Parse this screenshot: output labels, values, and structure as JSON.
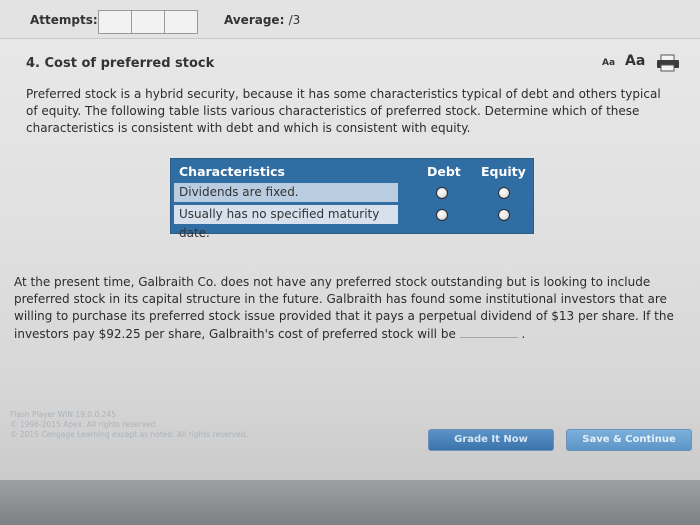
{
  "header": {
    "attempts_label": "Attempts:",
    "average_label": "Average:",
    "average_value": "/3"
  },
  "question": {
    "title": "4. Cost of preferred stock",
    "font_small": "Aa",
    "font_large": "Aa",
    "intro": "Preferred stock is a hybrid security, because it has some characteristics typical of debt and others typical of equity. The following table lists various characteristics of preferred stock. Determine which of these characteristics is consistent with debt and which is consistent with equity.",
    "table": {
      "headers": [
        "Characteristics",
        "Debt",
        "Equity"
      ],
      "rows": [
        "Dividends are fixed.",
        "Usually has no specified maturity date."
      ]
    },
    "paragraph": "At the present time, Galbraith Co. does not have any preferred stock outstanding but is looking to include preferred stock in its capital structure in the future. Galbraith has found some institutional investors that are willing to purchase its preferred stock issue provided that it pays a perpetual dividend of $13 per share. If the investors pay $92.25 per share, Galbraith's cost of preferred stock will be",
    "paragraph_end": "."
  },
  "footer": {
    "line1": "Flash Player WIN 19,0,0,245",
    "line2": "© 1996-2015 Apex. All rights reserved.",
    "line3": "© 2015 Cengage Learning except as noted. All rights reserved."
  },
  "buttons": {
    "grade": "Grade It Now",
    "save": "Save & Continue"
  },
  "colors": {
    "table_header": "#2f6da3",
    "row_alt": "#b9cce0",
    "row": "#d7e1ed",
    "button": "#3a73ab"
  },
  "icons": {
    "print": "print-icon"
  }
}
